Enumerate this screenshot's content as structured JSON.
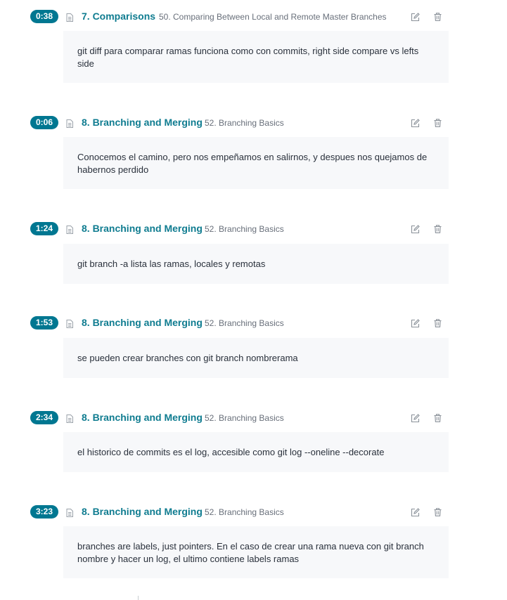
{
  "notes": [
    {
      "timestamp": "0:38",
      "section": "7. Comparisons",
      "lecture": "50. Comparing Between Local and Remote Master Branches",
      "body": "git diff para comparar ramas funciona como con commits, right side compare vs lefts side"
    },
    {
      "timestamp": "0:06",
      "section": "8. Branching and Merging",
      "lecture": "52. Branching Basics",
      "body": "Conocemos el camino, pero nos empeñamos en salirnos, y despues nos quejamos de habernos perdido"
    },
    {
      "timestamp": "1:24",
      "section": "8. Branching and Merging",
      "lecture": "52. Branching Basics",
      "body": "git branch -a lista las ramas, locales y remotas"
    },
    {
      "timestamp": "1:53",
      "section": "8. Branching and Merging",
      "lecture": "52. Branching Basics",
      "body": "se pueden crear branches con git branch nombrerama"
    },
    {
      "timestamp": "2:34",
      "section": "8. Branching and Merging",
      "lecture": "52. Branching Basics",
      "body": "el historico de commits es el log, accesible como git log --oneline --decorate"
    },
    {
      "timestamp": "3:23",
      "section": "8. Branching and Merging",
      "lecture": "52. Branching Basics",
      "body": "branches are labels, just pointers. En el caso de crear una rama nueva con git branch nombre y hacer un log, el ultimo contiene labels ramas"
    }
  ],
  "icons": {
    "note": "document-icon",
    "edit": "edit-icon",
    "delete": "trash-icon"
  },
  "colors": {
    "accent": "#007791",
    "section_link": "#0f7c90",
    "note_background": "#f7f8fa",
    "muted_text": "#686f7a",
    "icon_gray": "#8a9199"
  }
}
